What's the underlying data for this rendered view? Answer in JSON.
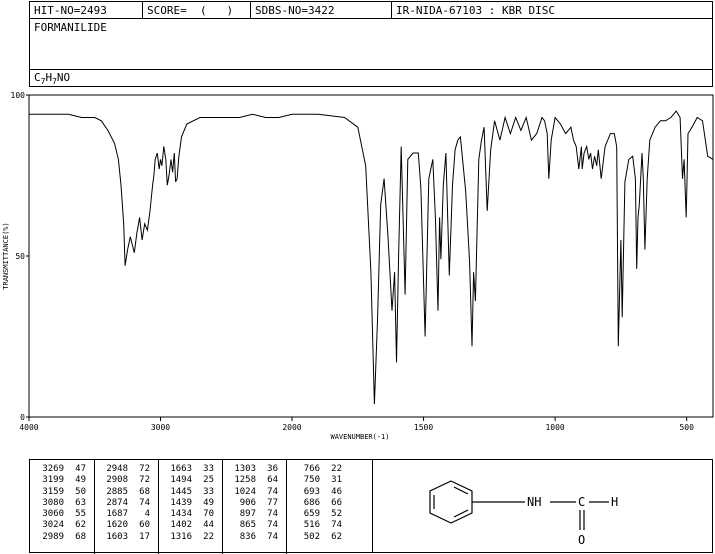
{
  "header": {
    "hit_no": "HIT-NO=2493",
    "score": "SCORE=  (   )",
    "sdbs_no": "SDBS-NO=3422",
    "ir_code": "IR-NIDA-67103 : KBR DISC"
  },
  "compound": {
    "name": "FORMANILIDE",
    "formula_parts": [
      "C",
      "7",
      "H",
      "7",
      "NO"
    ]
  },
  "chart_data": {
    "type": "line",
    "xlabel": "WAVENUMBER(-1)",
    "ylabel": "TRANSMITTANCE(%)",
    "xlim": [
      4000,
      400
    ],
    "ylim": [
      0,
      100
    ],
    "x_ticks": [
      4000,
      3000,
      2000,
      1500,
      1000,
      500
    ],
    "y_ticks": [
      100,
      50,
      0
    ],
    "series": [
      {
        "x": [
          4000,
          3900,
          3800,
          3700,
          3600,
          3500,
          3450,
          3400,
          3350,
          3320,
          3300,
          3280,
          3269,
          3250,
          3230,
          3199,
          3180,
          3159,
          3140,
          3120,
          3100,
          3080,
          3070,
          3060,
          3050,
          3040,
          3024,
          3010,
          3000,
          2989,
          2975,
          2960,
          2948,
          2935,
          2920,
          2908,
          2895,
          2885,
          2874,
          2860,
          2840,
          2800,
          2700,
          2600,
          2500,
          2400,
          2300,
          2200,
          2100,
          2000,
          1900,
          1800,
          1750,
          1720,
          1700,
          1687,
          1675,
          1663,
          1650,
          1635,
          1620,
          1610,
          1603,
          1595,
          1585,
          1570,
          1560,
          1540,
          1520,
          1510,
          1494,
          1480,
          1465,
          1455,
          1445,
          1439,
          1434,
          1425,
          1415,
          1402,
          1390,
          1380,
          1370,
          1360,
          1340,
          1325,
          1316,
          1310,
          1303,
          1290,
          1280,
          1270,
          1258,
          1245,
          1230,
          1210,
          1190,
          1170,
          1150,
          1130,
          1110,
          1090,
          1070,
          1050,
          1040,
          1030,
          1024,
          1015,
          1000,
          990,
          980,
          960,
          940,
          930,
          920,
          910,
          906,
          900,
          897,
          890,
          880,
          872,
          865,
          858,
          850,
          842,
          836,
          825,
          810,
          790,
          775,
          766,
          760,
          750,
          745,
          735,
          720,
          705,
          695,
          690,
          685,
          680,
          670,
          665,
          659,
          650,
          640,
          620,
          600,
          580,
          560,
          540,
          525,
          516,
          510,
          502,
          495,
          480,
          460,
          440,
          420,
          400
        ],
        "y": [
          94,
          94,
          94,
          94,
          93,
          93,
          92,
          89,
          85,
          80,
          72,
          60,
          47,
          52,
          56,
          51,
          57,
          62,
          55,
          60,
          58,
          64,
          68,
          72,
          75,
          80,
          82,
          77,
          80,
          78,
          84,
          80,
          72,
          75,
          80,
          76,
          82,
          73,
          74,
          81,
          87,
          91,
          93,
          93,
          93,
          93,
          94,
          93,
          93,
          94,
          94,
          93,
          90,
          78,
          45,
          4,
          30,
          66,
          74,
          56,
          33,
          45,
          17,
          50,
          84,
          38,
          80,
          82,
          82,
          71,
          25,
          74,
          80,
          62,
          33,
          62,
          49,
          72,
          82,
          44,
          72,
          83,
          86,
          87,
          70,
          48,
          22,
          45,
          36,
          80,
          86,
          90,
          64,
          83,
          92,
          86,
          93,
          88,
          93,
          89,
          93,
          86,
          88,
          93,
          92,
          88,
          74,
          86,
          93,
          92,
          91,
          88,
          90,
          86,
          84,
          77,
          80,
          84,
          77,
          82,
          84,
          80,
          82,
          77,
          81,
          78,
          83,
          74,
          84,
          88,
          88,
          84,
          22,
          55,
          31,
          73,
          80,
          81,
          74,
          46,
          62,
          66,
          82,
          74,
          52,
          74,
          86,
          90,
          92,
          92,
          93,
          95,
          93,
          74,
          80,
          62,
          88,
          90,
          93,
          92,
          81,
          80
        ]
      }
    ]
  },
  "peak_table": {
    "columns": [
      [
        [
          "3269",
          "47"
        ],
        [
          "3199",
          "49"
        ],
        [
          "3159",
          "50"
        ],
        [
          "3080",
          "63"
        ],
        [
          "3060",
          "55"
        ],
        [
          "3024",
          "62"
        ],
        [
          "2989",
          "68"
        ]
      ],
      [
        [
          "2948",
          "72"
        ],
        [
          "2908",
          "72"
        ],
        [
          "2885",
          "68"
        ],
        [
          "2874",
          "74"
        ],
        [
          "1687",
          "4"
        ],
        [
          "1620",
          "60"
        ],
        [
          "1603",
          "17"
        ]
      ],
      [
        [
          "1663",
          "33"
        ],
        [
          "1494",
          "25"
        ],
        [
          "1445",
          "33"
        ],
        [
          "1439",
          "49"
        ],
        [
          "1434",
          "70"
        ],
        [
          "1402",
          "44"
        ],
        [
          "1316",
          "22"
        ]
      ],
      [
        [
          "1303",
          "36"
        ],
        [
          "1258",
          "64"
        ],
        [
          "1024",
          "74"
        ],
        [
          "906",
          "77"
        ],
        [
          "897",
          "74"
        ],
        [
          "865",
          "74"
        ],
        [
          "836",
          "74"
        ]
      ],
      [
        [
          "766",
          "22"
        ],
        [
          "750",
          "31"
        ],
        [
          "693",
          "46"
        ],
        [
          "686",
          "66"
        ],
        [
          "659",
          "52"
        ],
        [
          "516",
          "74"
        ],
        [
          "502",
          "62"
        ]
      ]
    ]
  },
  "structure": {
    "atoms": [
      "NH",
      "C",
      "H",
      "O"
    ]
  }
}
